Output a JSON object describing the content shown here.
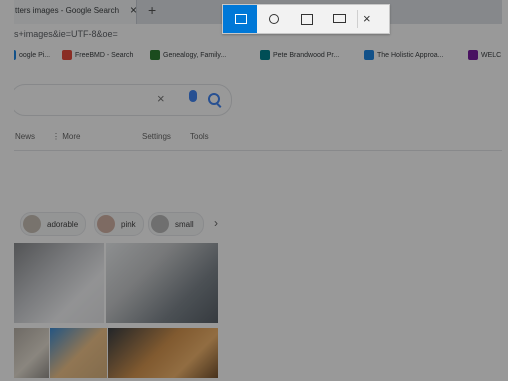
{
  "browser": {
    "tab_title": "tters images - Google Search",
    "tab_close": "×",
    "new_tab": "+",
    "url": "s+images&ie=UTF-8&oe="
  },
  "bookmarks": [
    {
      "label": "oogle Pi...",
      "icon": "google-icon"
    },
    {
      "label": "FreeBMD - Search",
      "icon": "freebmd-icon"
    },
    {
      "label": "Genealogy, Family...",
      "icon": "genealogy-icon"
    },
    {
      "label": "Pete Brandwood Pr...",
      "icon": "bookmark-icon"
    },
    {
      "label": "The Holistic Approa...",
      "icon": "bookmark-icon"
    },
    {
      "label": "WELC",
      "icon": "bookmark-icon"
    }
  ],
  "search": {
    "clear": "×"
  },
  "nav": {
    "news": "News",
    "more": "⋮ More",
    "settings": "Settings",
    "tools": "Tools"
  },
  "chips": [
    {
      "label": "adorable"
    },
    {
      "label": "pink"
    },
    {
      "label": "small"
    }
  ],
  "chips_next": "›",
  "snip": {
    "close": "×"
  }
}
